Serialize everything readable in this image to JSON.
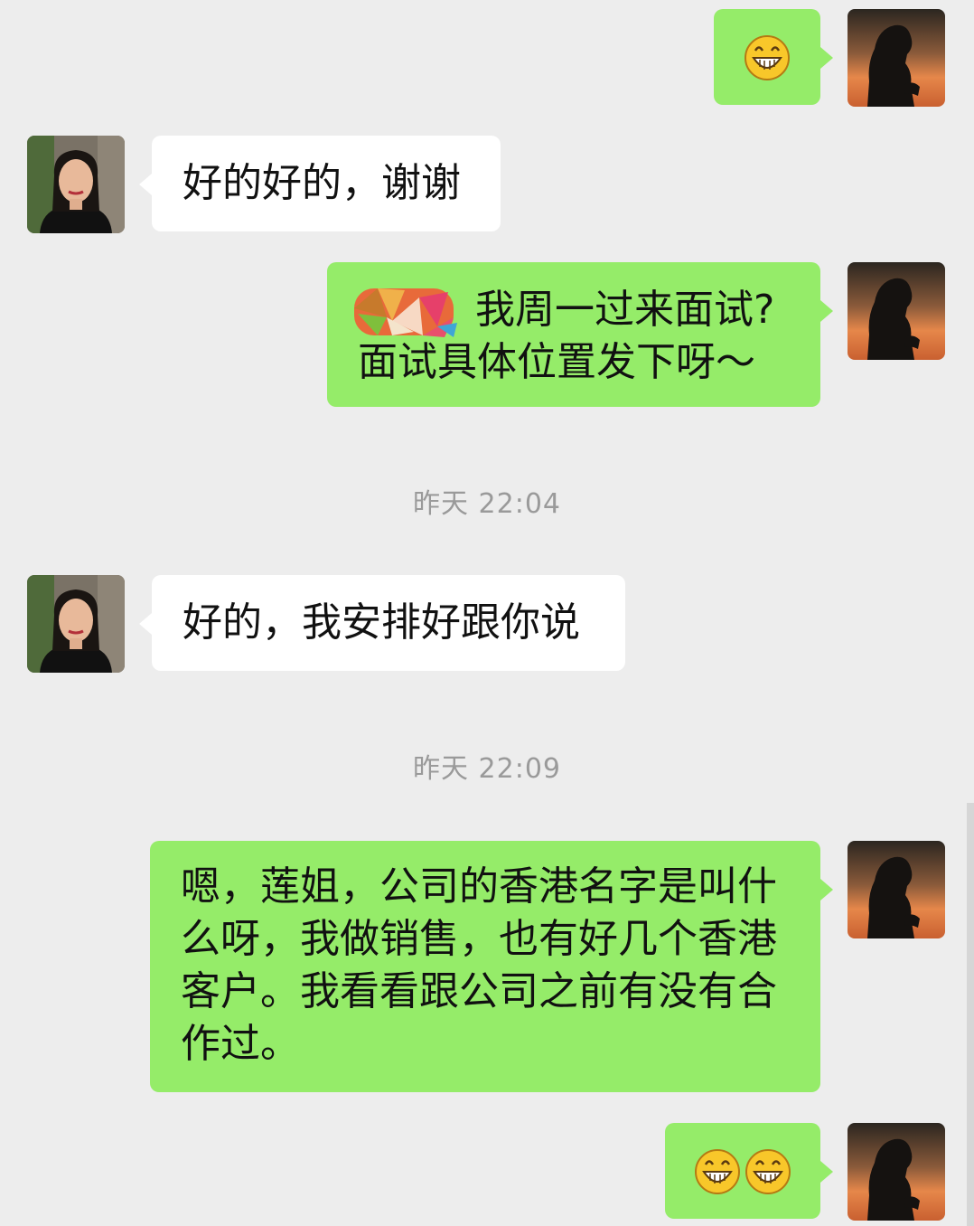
{
  "conversation": {
    "msg1": {
      "sender": "me",
      "emoji": "grin-emoji"
    },
    "msg2": {
      "sender": "contact",
      "text": "好的好的，谢谢"
    },
    "msg3": {
      "sender": "me",
      "line1": "我周一过来面试?",
      "line2": "面试具体位置发下呀～"
    },
    "time1": "昨天 22:04",
    "msg4": {
      "sender": "contact",
      "text": "好的，我安排好跟你说"
    },
    "time2": "昨天 22:09",
    "msg5": {
      "sender": "me",
      "lines": [
        "嗯，莲姐，公司的香港名字是叫什",
        "么呀，我做销售，也有好几个香港",
        "客户。我看看跟公司之前有没有合",
        "作过。"
      ]
    },
    "msg6": {
      "sender": "me",
      "emojis": [
        "grin-emoji",
        "grin-emoji"
      ]
    }
  },
  "colors": {
    "background": "#ededed",
    "outgoing_bubble": "#95ec69",
    "incoming_bubble": "#ffffff",
    "timestamp_text": "#9a9a9a"
  }
}
